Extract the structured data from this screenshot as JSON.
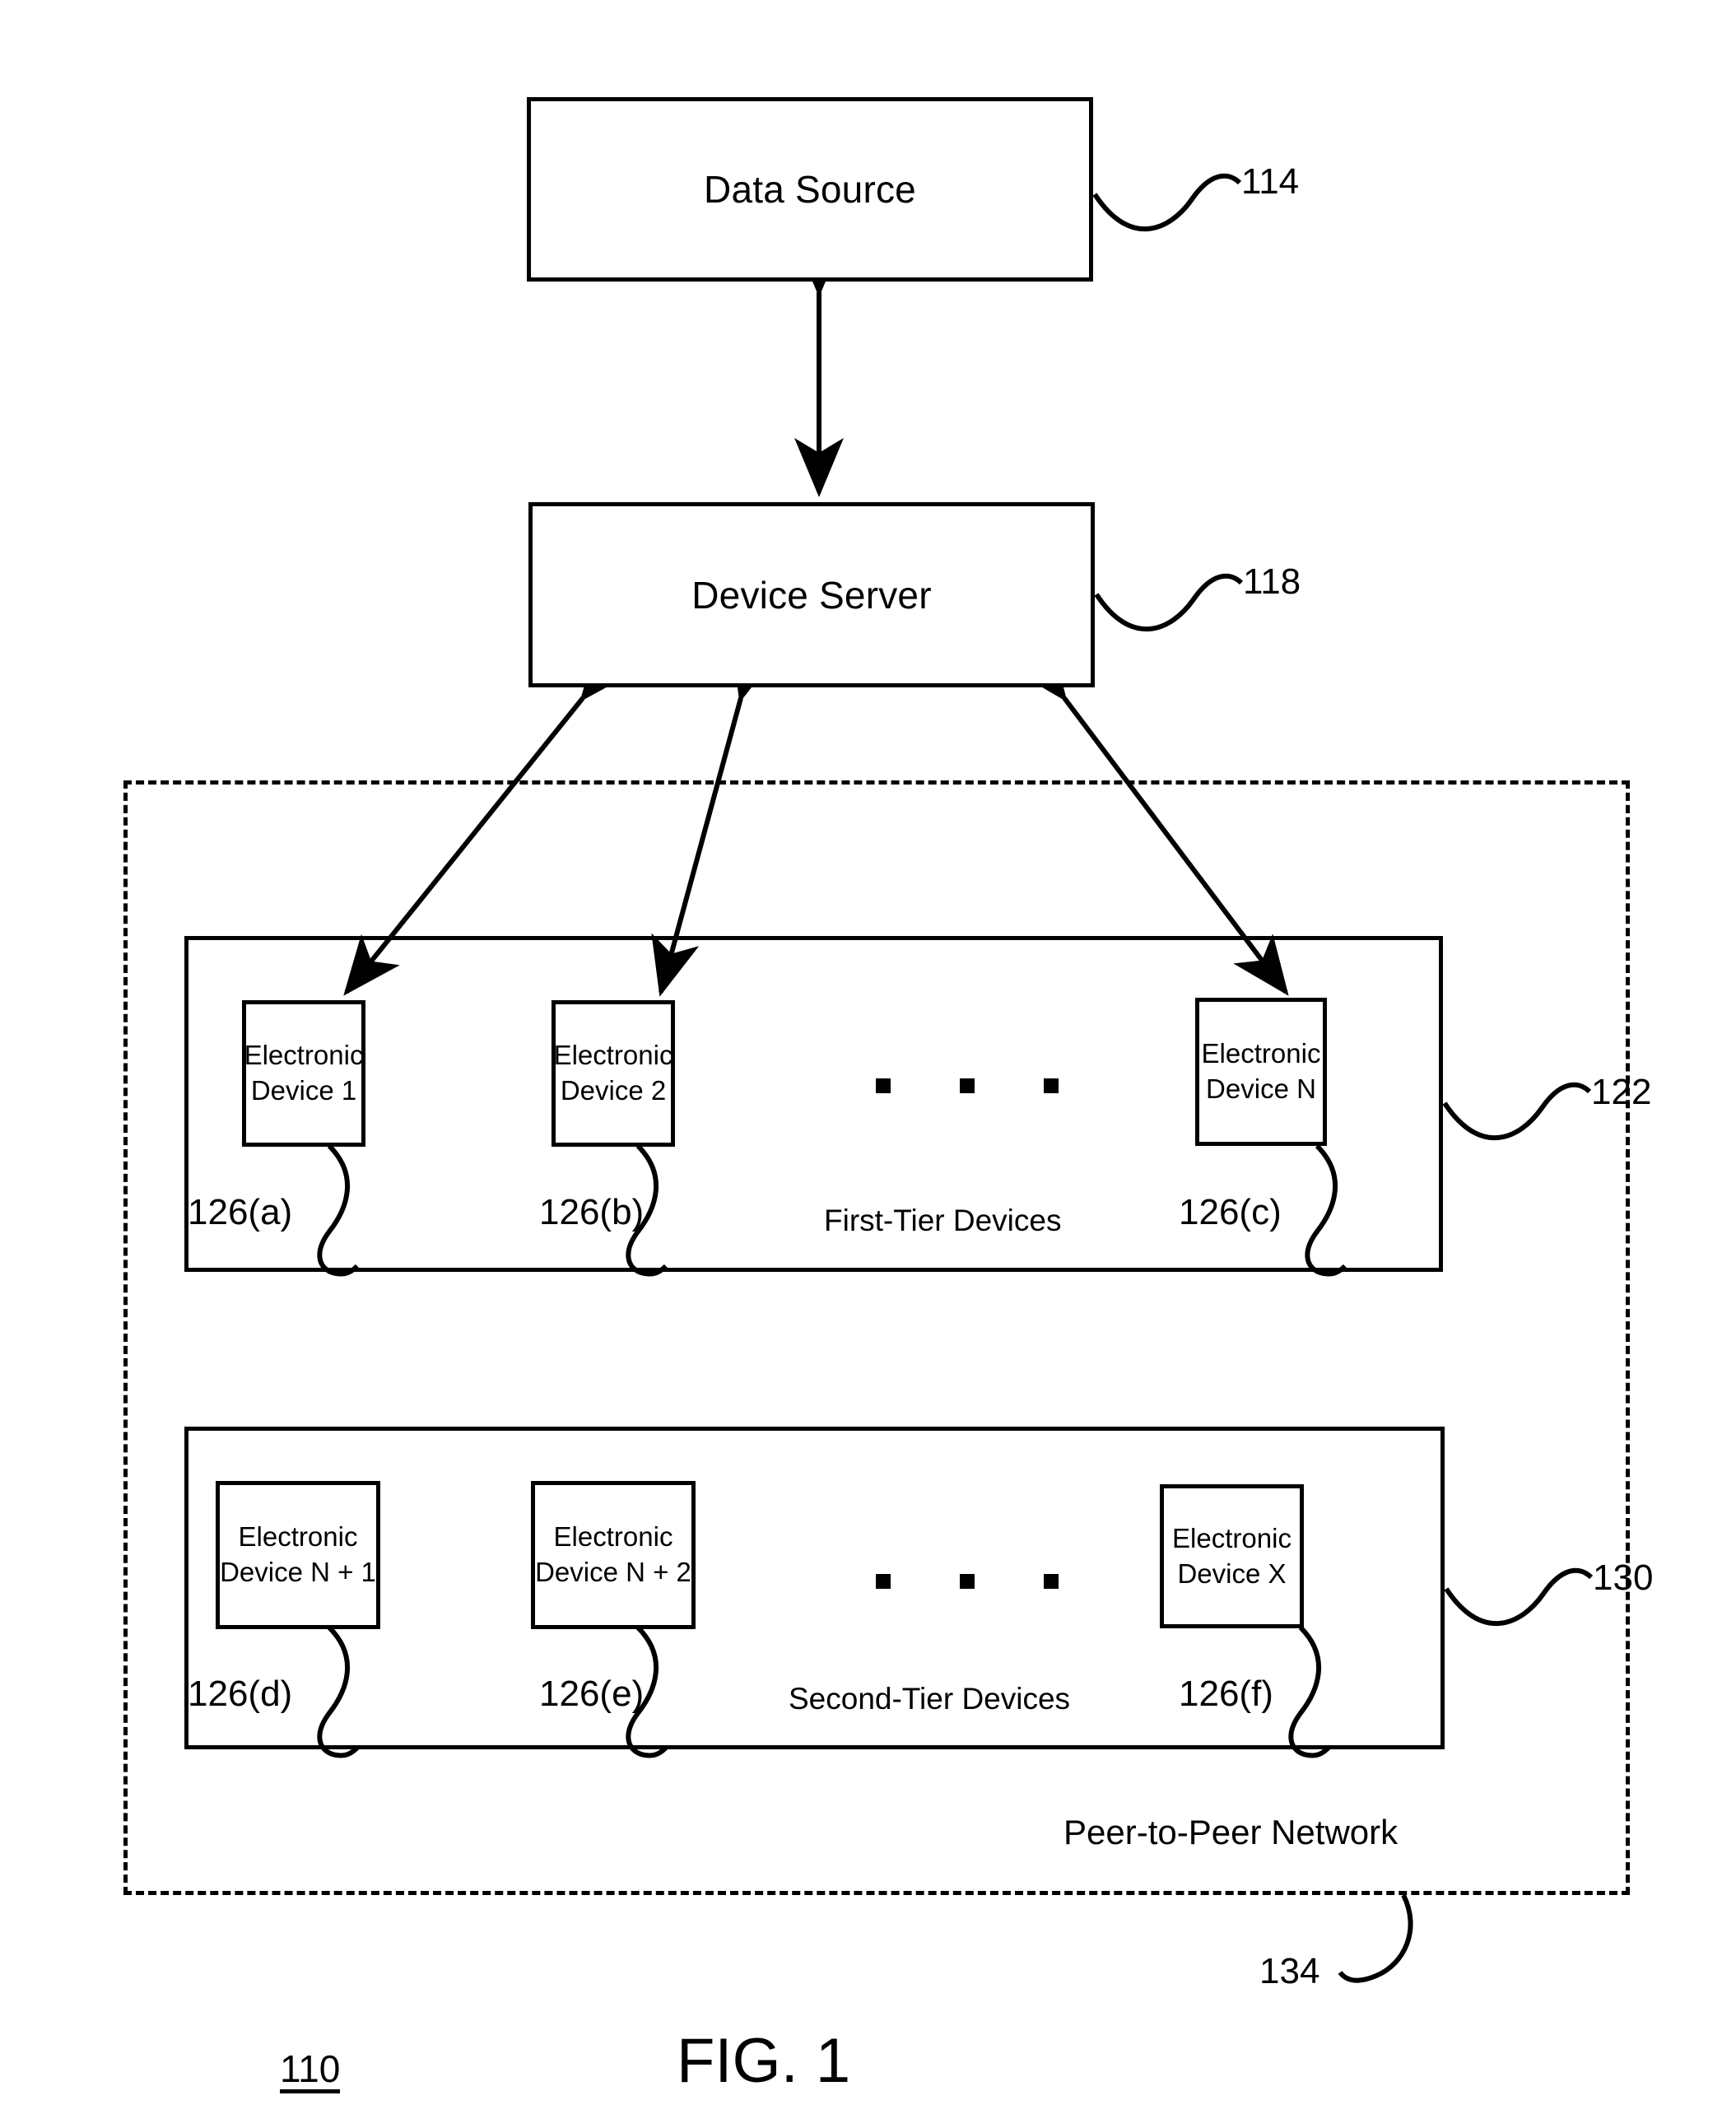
{
  "figure": {
    "caption": "FIG. 1",
    "system_number": "110"
  },
  "nodes": {
    "data_source": {
      "label": "Data Source",
      "ref": "114"
    },
    "device_server": {
      "label": "Device Server",
      "ref": "118"
    }
  },
  "tiers": [
    {
      "name": "first_tier",
      "label": "First-Tier Devices",
      "ref": "122",
      "devices": [
        {
          "line1": "Electronic",
          "line2": "Device 1",
          "ref": "126(a)"
        },
        {
          "line1": "Electronic",
          "line2": "Device 2",
          "ref": "126(b)"
        },
        {
          "line1": "Electronic",
          "line2": "Device N",
          "ref": "126(c)"
        }
      ],
      "ellipsis": "▪ ▪ ▪"
    },
    {
      "name": "second_tier",
      "label": "Second-Tier Devices",
      "ref": "130",
      "devices": [
        {
          "line1": "Electronic",
          "line2": "Device N + 1",
          "ref": "126(d)"
        },
        {
          "line1": "Electronic",
          "line2": "Device N + 2",
          "ref": "126(e)"
        },
        {
          "line1": "Electronic",
          "line2": "Device X",
          "ref": "126(f)"
        }
      ],
      "ellipsis": "▪ ▪ ▪"
    }
  ],
  "network": {
    "label": "Peer-to-Peer Network",
    "ref": "134"
  },
  "colors": {
    "stroke": "#000000",
    "background": "#ffffff"
  }
}
